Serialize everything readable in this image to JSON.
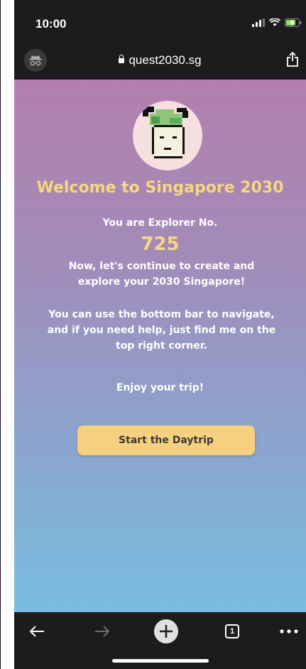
{
  "status_bar": {
    "time": "10:00"
  },
  "browser": {
    "url": "quest2030.sg"
  },
  "page": {
    "welcome_title": "Welcome to Singapore 2030",
    "explorer_label": "You are Explorer No.",
    "explorer_number": "725",
    "paragraph_1": "Now, let's continue to create and explore your 2030 Singapore!",
    "paragraph_2": "You can use the bottom bar to navigate, and if you need help, just find me on the top right corner.",
    "enjoy_text": "Enjoy your trip!",
    "start_button_label": "Start the Daytrip"
  },
  "toolbar": {
    "tab_count": "1"
  },
  "colors": {
    "accent": "#f6d77e",
    "button": "#f6d07e",
    "gradient_top": "#b47fae",
    "gradient_bottom": "#78bde0"
  }
}
